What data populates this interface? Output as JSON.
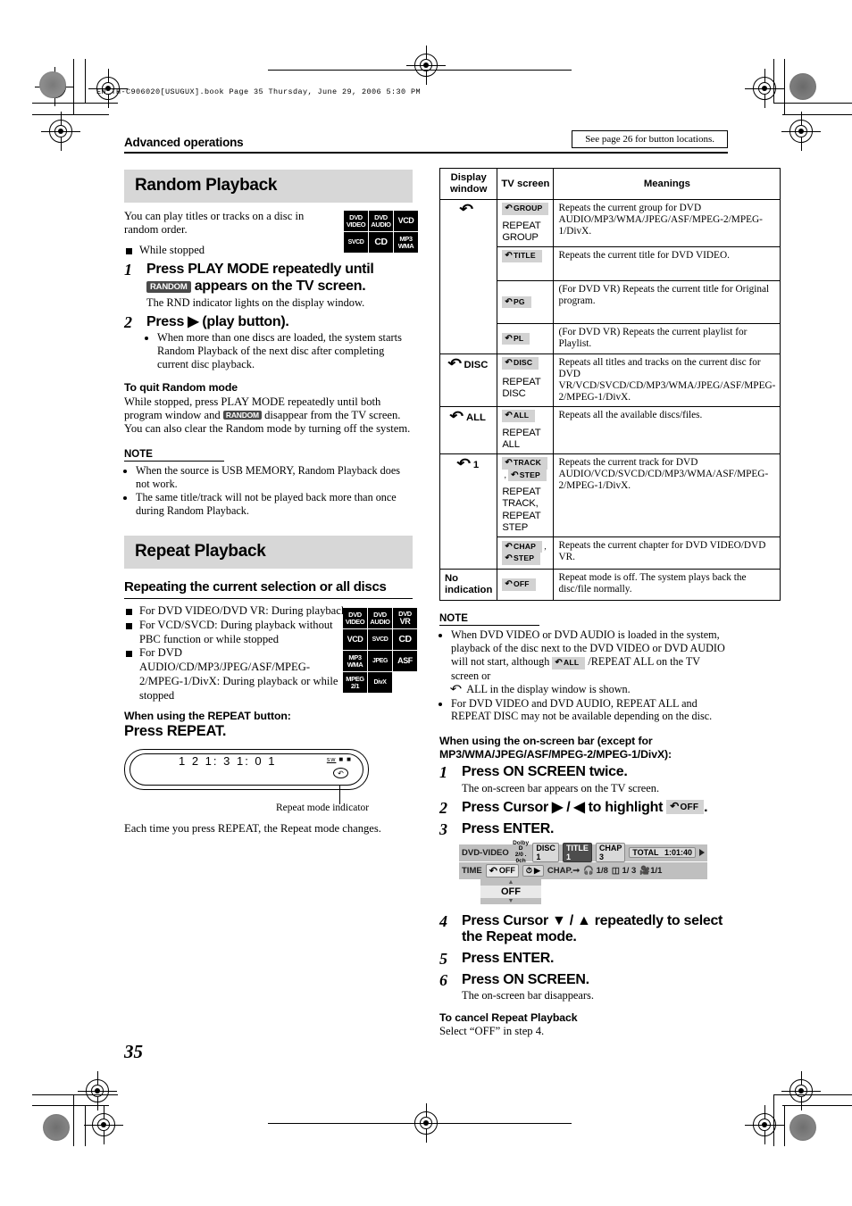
{
  "print": {
    "book_line": "EN_TH-C906020[USUGUX].book   Page 35   Thursday, June 29, 2006   5:30 PM"
  },
  "header": {
    "section": "Advanced operations",
    "see_page": "See page 26 for button locations."
  },
  "page_number": "35",
  "left_column": {
    "random": {
      "title": "Random Playback",
      "intro": "You can play titles or tracks on a disc in random order.",
      "condition": "While stopped",
      "discs": [
        {
          "l1": "DVD",
          "l2": "VIDEO"
        },
        {
          "l1": "DVD",
          "l2": "AUDIO"
        },
        {
          "l1": "VCD",
          "l2": ""
        },
        {
          "l1": "SVCD",
          "l2": ""
        },
        {
          "l1": "CD",
          "l2": ""
        },
        {
          "l1": "MP3",
          "l2": "WMA"
        }
      ],
      "steps": [
        {
          "num": "1",
          "head_before": "Press PLAY MODE repeatedly until",
          "badge": "RANDOM",
          "head_after": "appears on the TV screen.",
          "sub": "The RND indicator lights on the display window."
        },
        {
          "num": "2",
          "head": "Press ▶ (play button).",
          "bullets": [
            "When more than one discs are loaded, the system starts Random Playback of the next disc after completing current disc playback."
          ]
        }
      ],
      "quit_heading": "To quit Random mode",
      "quit_text_1": "While stopped, press PLAY MODE repeatedly until both program window and",
      "quit_badge": "RANDOM",
      "quit_text_2": "disappear from the TV screen.",
      "quit_text_3": "You can also clear the Random mode by turning off the system.",
      "note_heading": "NOTE",
      "notes": [
        "When the source is USB MEMORY, Random Playback does not work.",
        "The same title/track will not be played back more than once during Random Playback."
      ]
    },
    "repeat": {
      "title": "Repeat Playback",
      "subtitle": "Repeating the current selection or all discs",
      "conditions": [
        "For DVD VIDEO/DVD VR: During playback",
        "For VCD/SVCD: During playback without PBC function or while stopped",
        "For DVD AUDIO/CD/MP3/JPEG/ASF/MPEG-2/MPEG-1/DivX: During playback or while stopped"
      ],
      "discs": [
        {
          "l1": "DVD",
          "l2": "VIDEO"
        },
        {
          "l1": "DVD",
          "l2": "AUDIO"
        },
        {
          "l1": "DVD",
          "l2": "VR"
        },
        {
          "l1": "VCD",
          "l2": ""
        },
        {
          "l1": "SVCD",
          "l2": ""
        },
        {
          "l1": "CD",
          "l2": ""
        },
        {
          "l1": "MP3",
          "l2": "WMA"
        },
        {
          "l1": "JPEG",
          "l2": ""
        },
        {
          "l1": "ASF",
          "l2": ""
        },
        {
          "l1": "MPEG",
          "l2": "2/1"
        },
        {
          "l1": "DivX",
          "l2": ""
        }
      ],
      "when_using": "When using the REPEAT button:",
      "press": "Press REPEAT.",
      "display_digits": "1 2      1: 3 1: 0 1",
      "display_tiny": "sw",
      "indicator_label": "Repeat mode indicator",
      "after_text": "Each time you press REPEAT, the Repeat mode changes."
    }
  },
  "right_column": {
    "table": {
      "headers": [
        "Display window",
        "TV screen",
        "Meanings"
      ],
      "rows": [
        {
          "display": "↺",
          "display_kind": "arrow",
          "groups": [
            {
              "tv_chips": [
                "GROUP"
              ],
              "tv_text": "REPEAT GROUP",
              "meaning": "Repeats the current group for DVD AUDIO/MP3/WMA/JPEG/ASF/MPEG-2/MPEG-1/DivX."
            },
            {
              "tv_chips": [
                "TITLE"
              ],
              "tv_text": "",
              "meaning": "Repeats the current title for DVD VIDEO."
            },
            {
              "tv_chips": [
                "PG"
              ],
              "tv_text": "",
              "meaning": "(For DVD VR) Repeats the current title for Original program."
            },
            {
              "tv_chips": [
                "PL"
              ],
              "tv_text": "",
              "meaning": "(For DVD VR) Repeats the current playlist for Playlist."
            }
          ]
        },
        {
          "display": "DISC",
          "display_kind": "arrow-label",
          "groups": [
            {
              "tv_chips": [
                "DISC"
              ],
              "tv_text": "REPEAT DISC",
              "meaning": "Repeats all titles and tracks on the current disc for DVD VR/VCD/SVCD/CD/MP3/WMA/JPEG/ASF/MPEG-2/MPEG-1/DivX."
            }
          ]
        },
        {
          "display": "ALL",
          "display_kind": "arrow-label",
          "groups": [
            {
              "tv_chips": [
                "ALL"
              ],
              "tv_text": "REPEAT ALL",
              "meaning": "Repeats all the available discs/files."
            }
          ]
        },
        {
          "display": "1",
          "display_kind": "arrow-label",
          "groups": [
            {
              "tv_chips": [
                "TRACK",
                "STEP"
              ],
              "tv_text": "REPEAT TRACK, REPEAT STEP",
              "meaning": "Repeats the current track for DVD AUDIO/VCD/SVCD/CD/MP3/WMA/ASF/MPEG-2/MPEG-1/DivX."
            },
            {
              "tv_chips": [
                "CHAP",
                "STEP"
              ],
              "tv_text": "",
              "meaning": "Repeats the current chapter for DVD VIDEO/DVD VR."
            }
          ]
        },
        {
          "display": "No indication",
          "display_kind": "text",
          "groups": [
            {
              "tv_chips": [
                "OFF"
              ],
              "tv_text": "",
              "meaning": "Repeat mode is off. The system plays back the disc/file normally."
            }
          ]
        }
      ]
    },
    "note_heading": "NOTE",
    "notes": [
      {
        "part1": "When DVD VIDEO or DVD AUDIO is loaded in the system, playback of the disc next to the DVD VIDEO or DVD AUDIO will not start, although",
        "chip": "ALL",
        "part2": "/REPEAT ALL on the TV screen or",
        "part3": "ALL in the display window is shown."
      },
      {
        "part1": "For DVD VIDEO and DVD AUDIO, REPEAT ALL and REPEAT DISC may not be available depending on the disc.",
        "chip": "",
        "part2": "",
        "part3": ""
      }
    ],
    "onscreen_heading": "When using the on-screen bar (except for MP3/WMA/JPEG/ASF/MPEG-2/MPEG-1/DivX):",
    "steps": [
      {
        "num": "1",
        "head": "Press ON SCREEN twice.",
        "sub": "The on-screen bar appears on the TV screen."
      },
      {
        "num": "2",
        "head_before": "Press Cursor ▶ / ◀ to highlight",
        "chip": "OFF",
        "head_after": ".",
        "sub": ""
      },
      {
        "num": "3",
        "head": "Press ENTER.",
        "sub": ""
      },
      {
        "num": "4",
        "head": "Press Cursor ▼ / ▲ repeatedly to select the Repeat mode.",
        "sub": ""
      },
      {
        "num": "5",
        "head": "Press ENTER.",
        "sub": ""
      },
      {
        "num": "6",
        "head": "Press ON SCREEN.",
        "sub": "The on-screen bar disappears."
      }
    ],
    "onscreen_bar": {
      "disc_type": "DVD-VIDEO",
      "audio_l1": "Dolby D",
      "audio_l2": "2/0 . 0ch",
      "disc": "DISC 1",
      "title": "TITLE 1",
      "chap": "CHAP  3",
      "total_label": "TOTAL",
      "total_time": "1:01:40",
      "row2": {
        "time": "TIME",
        "repeat": "OFF",
        "clock": "▶",
        "chapter": "CHAP.",
        "audio": "1/8",
        "subtitle": "1/ 3",
        "angle": "1/1"
      },
      "dropdown_value": "OFF"
    },
    "cancel_heading": "To cancel Repeat Playback",
    "cancel_text": "Select “OFF” in step 4."
  }
}
